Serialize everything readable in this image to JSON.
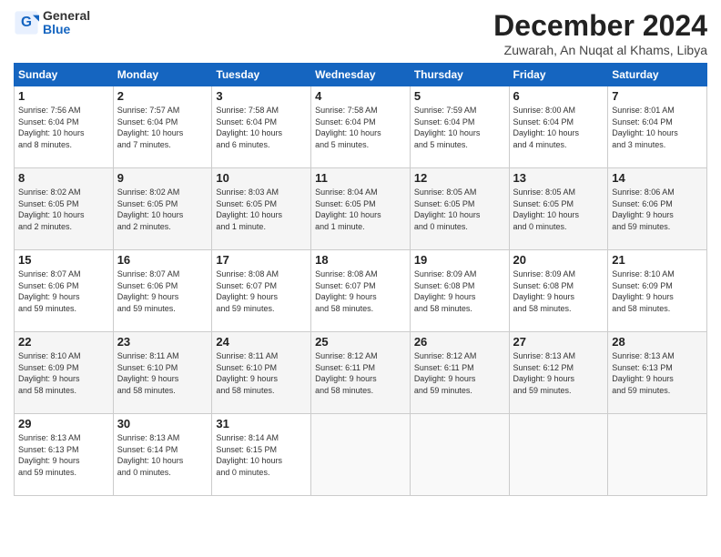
{
  "header": {
    "logo_general": "General",
    "logo_blue": "Blue",
    "month_title": "December 2024",
    "location": "Zuwarah, An Nuqat al Khams, Libya"
  },
  "days_of_week": [
    "Sunday",
    "Monday",
    "Tuesday",
    "Wednesday",
    "Thursday",
    "Friday",
    "Saturday"
  ],
  "weeks": [
    [
      {
        "day": "1",
        "info": "Sunrise: 7:56 AM\nSunset: 6:04 PM\nDaylight: 10 hours\nand 8 minutes."
      },
      {
        "day": "2",
        "info": "Sunrise: 7:57 AM\nSunset: 6:04 PM\nDaylight: 10 hours\nand 7 minutes."
      },
      {
        "day": "3",
        "info": "Sunrise: 7:58 AM\nSunset: 6:04 PM\nDaylight: 10 hours\nand 6 minutes."
      },
      {
        "day": "4",
        "info": "Sunrise: 7:58 AM\nSunset: 6:04 PM\nDaylight: 10 hours\nand 5 minutes."
      },
      {
        "day": "5",
        "info": "Sunrise: 7:59 AM\nSunset: 6:04 PM\nDaylight: 10 hours\nand 5 minutes."
      },
      {
        "day": "6",
        "info": "Sunrise: 8:00 AM\nSunset: 6:04 PM\nDaylight: 10 hours\nand 4 minutes."
      },
      {
        "day": "7",
        "info": "Sunrise: 8:01 AM\nSunset: 6:04 PM\nDaylight: 10 hours\nand 3 minutes."
      }
    ],
    [
      {
        "day": "8",
        "info": "Sunrise: 8:02 AM\nSunset: 6:05 PM\nDaylight: 10 hours\nand 2 minutes."
      },
      {
        "day": "9",
        "info": "Sunrise: 8:02 AM\nSunset: 6:05 PM\nDaylight: 10 hours\nand 2 minutes."
      },
      {
        "day": "10",
        "info": "Sunrise: 8:03 AM\nSunset: 6:05 PM\nDaylight: 10 hours\nand 1 minute."
      },
      {
        "day": "11",
        "info": "Sunrise: 8:04 AM\nSunset: 6:05 PM\nDaylight: 10 hours\nand 1 minute."
      },
      {
        "day": "12",
        "info": "Sunrise: 8:05 AM\nSunset: 6:05 PM\nDaylight: 10 hours\nand 0 minutes."
      },
      {
        "day": "13",
        "info": "Sunrise: 8:05 AM\nSunset: 6:05 PM\nDaylight: 10 hours\nand 0 minutes."
      },
      {
        "day": "14",
        "info": "Sunrise: 8:06 AM\nSunset: 6:06 PM\nDaylight: 9 hours\nand 59 minutes."
      }
    ],
    [
      {
        "day": "15",
        "info": "Sunrise: 8:07 AM\nSunset: 6:06 PM\nDaylight: 9 hours\nand 59 minutes."
      },
      {
        "day": "16",
        "info": "Sunrise: 8:07 AM\nSunset: 6:06 PM\nDaylight: 9 hours\nand 59 minutes."
      },
      {
        "day": "17",
        "info": "Sunrise: 8:08 AM\nSunset: 6:07 PM\nDaylight: 9 hours\nand 59 minutes."
      },
      {
        "day": "18",
        "info": "Sunrise: 8:08 AM\nSunset: 6:07 PM\nDaylight: 9 hours\nand 58 minutes."
      },
      {
        "day": "19",
        "info": "Sunrise: 8:09 AM\nSunset: 6:08 PM\nDaylight: 9 hours\nand 58 minutes."
      },
      {
        "day": "20",
        "info": "Sunrise: 8:09 AM\nSunset: 6:08 PM\nDaylight: 9 hours\nand 58 minutes."
      },
      {
        "day": "21",
        "info": "Sunrise: 8:10 AM\nSunset: 6:09 PM\nDaylight: 9 hours\nand 58 minutes."
      }
    ],
    [
      {
        "day": "22",
        "info": "Sunrise: 8:10 AM\nSunset: 6:09 PM\nDaylight: 9 hours\nand 58 minutes."
      },
      {
        "day": "23",
        "info": "Sunrise: 8:11 AM\nSunset: 6:10 PM\nDaylight: 9 hours\nand 58 minutes."
      },
      {
        "day": "24",
        "info": "Sunrise: 8:11 AM\nSunset: 6:10 PM\nDaylight: 9 hours\nand 58 minutes."
      },
      {
        "day": "25",
        "info": "Sunrise: 8:12 AM\nSunset: 6:11 PM\nDaylight: 9 hours\nand 58 minutes."
      },
      {
        "day": "26",
        "info": "Sunrise: 8:12 AM\nSunset: 6:11 PM\nDaylight: 9 hours\nand 59 minutes."
      },
      {
        "day": "27",
        "info": "Sunrise: 8:13 AM\nSunset: 6:12 PM\nDaylight: 9 hours\nand 59 minutes."
      },
      {
        "day": "28",
        "info": "Sunrise: 8:13 AM\nSunset: 6:13 PM\nDaylight: 9 hours\nand 59 minutes."
      }
    ],
    [
      {
        "day": "29",
        "info": "Sunrise: 8:13 AM\nSunset: 6:13 PM\nDaylight: 9 hours\nand 59 minutes."
      },
      {
        "day": "30",
        "info": "Sunrise: 8:13 AM\nSunset: 6:14 PM\nDaylight: 10 hours\nand 0 minutes."
      },
      {
        "day": "31",
        "info": "Sunrise: 8:14 AM\nSunset: 6:15 PM\nDaylight: 10 hours\nand 0 minutes."
      },
      {
        "day": "",
        "info": ""
      },
      {
        "day": "",
        "info": ""
      },
      {
        "day": "",
        "info": ""
      },
      {
        "day": "",
        "info": ""
      }
    ]
  ]
}
